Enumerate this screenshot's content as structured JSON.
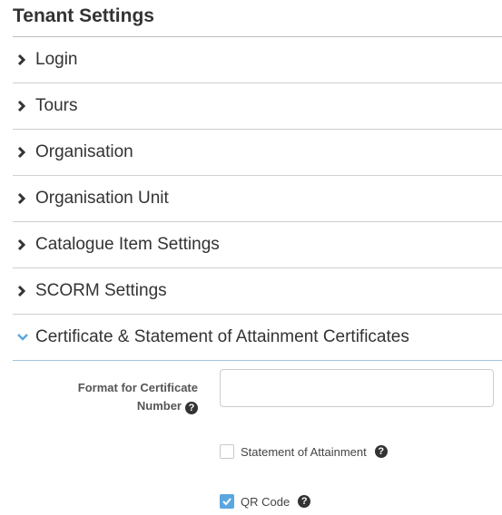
{
  "page": {
    "title": "Tenant Settings"
  },
  "accordion": {
    "items": [
      {
        "label": "Login",
        "expanded": false
      },
      {
        "label": "Tours",
        "expanded": false
      },
      {
        "label": "Organisation",
        "expanded": false
      },
      {
        "label": "Organisation Unit",
        "expanded": false
      },
      {
        "label": "Catalogue Item Settings",
        "expanded": false
      },
      {
        "label": "SCORM Settings",
        "expanded": false
      },
      {
        "label": "Certificate & Statement of Attainment Certificates",
        "expanded": true
      }
    ]
  },
  "certificate_panel": {
    "format_label_line1": "Format for Certificate",
    "format_label_line2": "Number",
    "format_value": "",
    "format_placeholder": "",
    "statement_of_attainment_label": "Statement of Attainment",
    "statement_of_attainment_checked": false,
    "qr_code_label": "QR Code",
    "qr_code_checked": true,
    "help_glyph": "?"
  },
  "colors": {
    "accent": "#5aa7e0",
    "expanded_chevron": "#5aa7e0",
    "text": "#333333",
    "divider": "#cfcfcf"
  },
  "icons": {
    "collapsed": "chevron-right-icon",
    "expanded": "chevron-down-icon",
    "help": "question-circle-icon"
  }
}
